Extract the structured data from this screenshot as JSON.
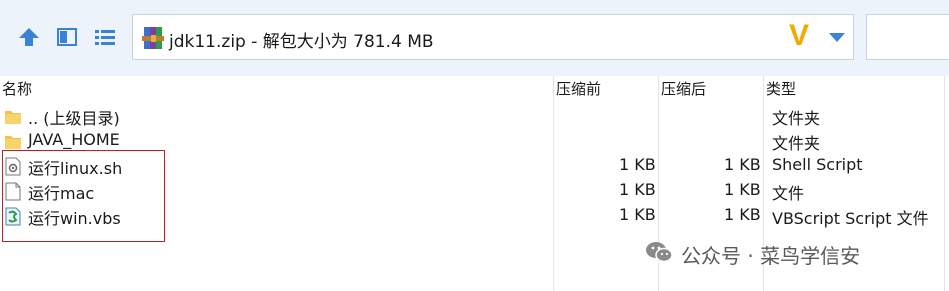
{
  "toolbar": {
    "up_icon": "arrow-up-icon",
    "view_icon": "pane-view-icon",
    "list_icon": "list-view-icon"
  },
  "address": {
    "icon": "winrar-archive-icon",
    "text": "jdk11.zip - 解包大小为 781.4 MB",
    "brand_mark": "V"
  },
  "columns": {
    "name": "名称",
    "compressed": "压缩前",
    "packed": "压缩后",
    "type": "类型"
  },
  "files": [
    {
      "name": "..  (上级目录)",
      "size1": "",
      "size2": "",
      "type": "文件夹",
      "icon": "folder-icon"
    },
    {
      "name": "JAVA_HOME",
      "size1": "",
      "size2": "",
      "type": "文件夹",
      "icon": "folder-icon"
    },
    {
      "name": "运行linux.sh",
      "size1": "1 KB",
      "size2": "1 KB",
      "type": "Shell Script",
      "icon": "script-file-icon"
    },
    {
      "name": "运行mac",
      "size1": "1 KB",
      "size2": "1 KB",
      "type": "文件",
      "icon": "blank-file-icon"
    },
    {
      "name": "运行win.vbs",
      "size1": "1 KB",
      "size2": "1 KB",
      "type": "VBScript Script 文件",
      "icon": "vbs-file-icon"
    }
  ],
  "watermark": {
    "text": "公众号 · 菜鸟学信安",
    "icon": "wechat-icon"
  },
  "colors": {
    "toolbar_bg": "#edf3fb",
    "accent_blue": "#3b82d6",
    "highlight_red": "#b4232a",
    "folder_yellow": "#f2c14e"
  }
}
